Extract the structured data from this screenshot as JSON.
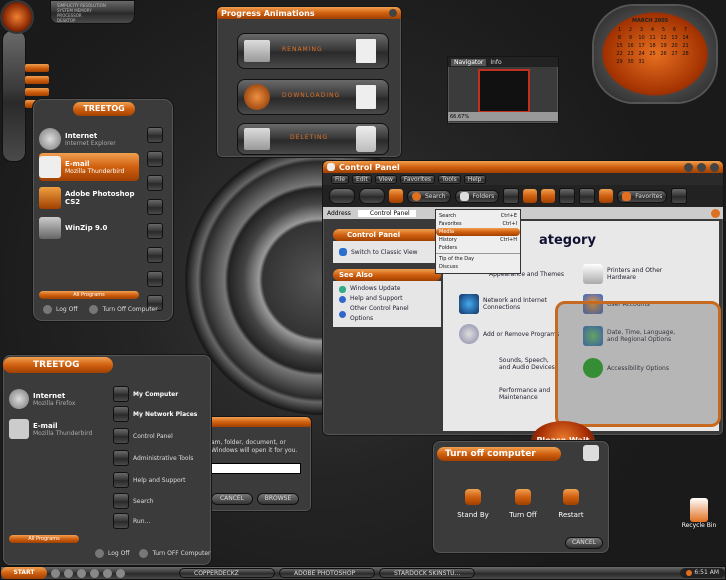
{
  "sysinfo": [
    "SIMPLICITY RESOLUTION",
    "SYSTEM MEMORY",
    "PROCESSOR",
    "DESKTOP"
  ],
  "progress": {
    "title": "Progress Animations",
    "items": [
      "RENAMING",
      "DOWNLOADING",
      "DELETING"
    ]
  },
  "navigator": {
    "tab1": "Navigator",
    "tab2": "Info",
    "zoom": "66.67%"
  },
  "calendar": {
    "month": "MARCH",
    "year": "2005",
    "days": [
      "1",
      "2",
      "3",
      "4",
      "5",
      "6",
      "7",
      "8",
      "9",
      "10",
      "11",
      "12",
      "13",
      "14",
      "15",
      "16",
      "17",
      "18",
      "19",
      "20",
      "21",
      "22",
      "23",
      "24",
      "25",
      "26",
      "27",
      "28",
      "29",
      "30",
      "31"
    ]
  },
  "start1": {
    "header": "TREETOG",
    "items": [
      {
        "title": "Internet",
        "sub": "Internet Explorer"
      },
      {
        "title": "E-mail",
        "sub": "Mozilla Thunderbird"
      },
      {
        "title": "Adobe Photoshop",
        "sub": "CS2"
      },
      {
        "title": "WinZip 9.0",
        "sub": ""
      }
    ],
    "all_programs": "All Programs",
    "logoff": "Log Off",
    "turnoff": "Turn Off Computer"
  },
  "control_panel": {
    "title": "Control Panel",
    "menu": [
      "File",
      "Edit",
      "View",
      "Favorites",
      "Tools",
      "Help"
    ],
    "toolbar": {
      "search": "Search",
      "folders": "Folders",
      "favorites": "Favorites"
    },
    "address_label": "Address",
    "address_value": "Control Panel",
    "view_menu": [
      {
        "label": "Search",
        "key": "Ctrl+E"
      },
      {
        "label": "Favorites",
        "key": "Ctrl+I"
      },
      {
        "label": "Media",
        "key": ""
      },
      {
        "label": "History",
        "key": "Ctrl+H"
      },
      {
        "label": "Folders",
        "key": ""
      },
      {
        "label": "Tip of the Day",
        "key": ""
      },
      {
        "label": "Discuss",
        "key": ""
      }
    ],
    "side_header": "Control Panel",
    "switch_view": "Switch to Classic View",
    "see_also": "See Also",
    "see_items": [
      "Windows Update",
      "Help and Support",
      "Other Control Panel Options"
    ],
    "category_heading": "ategory",
    "categories_left": [
      "Appearance and Themes",
      "Network and Internet Connections",
      "Add or Remove Programs",
      "Sounds, Speech, and Audio Devices",
      "Performance and Maintenance"
    ],
    "categories_right": [
      "Printers and Other Hardware",
      "User Accounts",
      "Date, Time, Language, and Regional Options",
      "Accessibility Options"
    ],
    "please_wait": "Please Wait"
  },
  "start2": {
    "header": "TREETOG",
    "left_items": [
      {
        "title": "Internet",
        "sub": "Mozilla Firefox"
      },
      {
        "title": "E-mail",
        "sub": "Mozilla Thunderbird"
      }
    ],
    "right_items": [
      "My Computer",
      "My Network Places",
      "Control Panel",
      "Administrative Tools",
      "Help and Support",
      "Search",
      "Run..."
    ],
    "all_programs": "All Programs",
    "logoff": "Log Off",
    "turnoff": "Turn OFF Computer"
  },
  "run": {
    "text1": "am, folder, document, or",
    "text2": "Windows will open it for you.",
    "cancel": "CANCEL",
    "browse": "BROWSE"
  },
  "turnoff": {
    "title": "Turn off computer",
    "standby": "Stand By",
    "turnoff": "Turn Off",
    "restart": "Restart",
    "cancel": "CANCEL"
  },
  "desktop": {
    "recycle": "Recycle Bin"
  },
  "taskbar": {
    "start": "START",
    "tasks": [
      "COPPERDECKZ",
      "ADOBE PHOTOSHOP",
      "STARDOCK SKINSTU..."
    ],
    "clock": "6:51 AM"
  },
  "colors": {
    "accent": "#e0701a",
    "chrome": "#3a3a3a"
  }
}
